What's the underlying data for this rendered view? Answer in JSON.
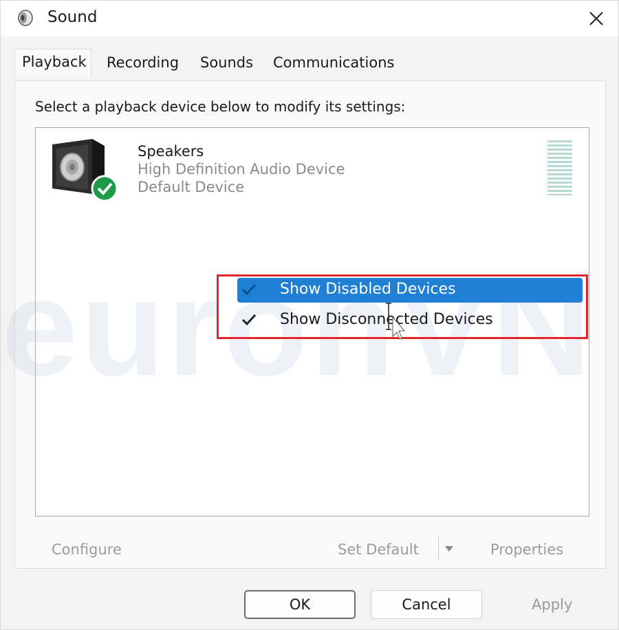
{
  "window": {
    "title": "Sound",
    "close_icon": "close-icon",
    "title_icon": "speaker-icon"
  },
  "tabs": [
    {
      "label": "Playback",
      "active": true
    },
    {
      "label": "Recording",
      "active": false
    },
    {
      "label": "Sounds",
      "active": false
    },
    {
      "label": "Communications",
      "active": false
    }
  ],
  "playback": {
    "instruction": "Select a playback device below to modify its settings:",
    "devices": [
      {
        "name": "Speakers",
        "description": "High Definition Audio Device",
        "status": "Default Device",
        "icon": "speaker-device-icon",
        "badge": "check-badge-icon"
      }
    ]
  },
  "context_menu": {
    "items": [
      {
        "label": "Show Disabled Devices",
        "checked": true,
        "highlighted": true
      },
      {
        "label": "Show Disconnected Devices",
        "checked": true,
        "highlighted": false
      }
    ]
  },
  "watermark": "euronVN",
  "device_buttons": {
    "configure": "Configure",
    "set_default": "Set Default",
    "properties": "Properties"
  },
  "dialog_buttons": {
    "ok": "OK",
    "cancel": "Cancel",
    "apply": "Apply"
  },
  "colors": {
    "highlight": "#1f7fd2",
    "annotation_box": "#e0262a",
    "default_badge": "#1e9a48"
  }
}
